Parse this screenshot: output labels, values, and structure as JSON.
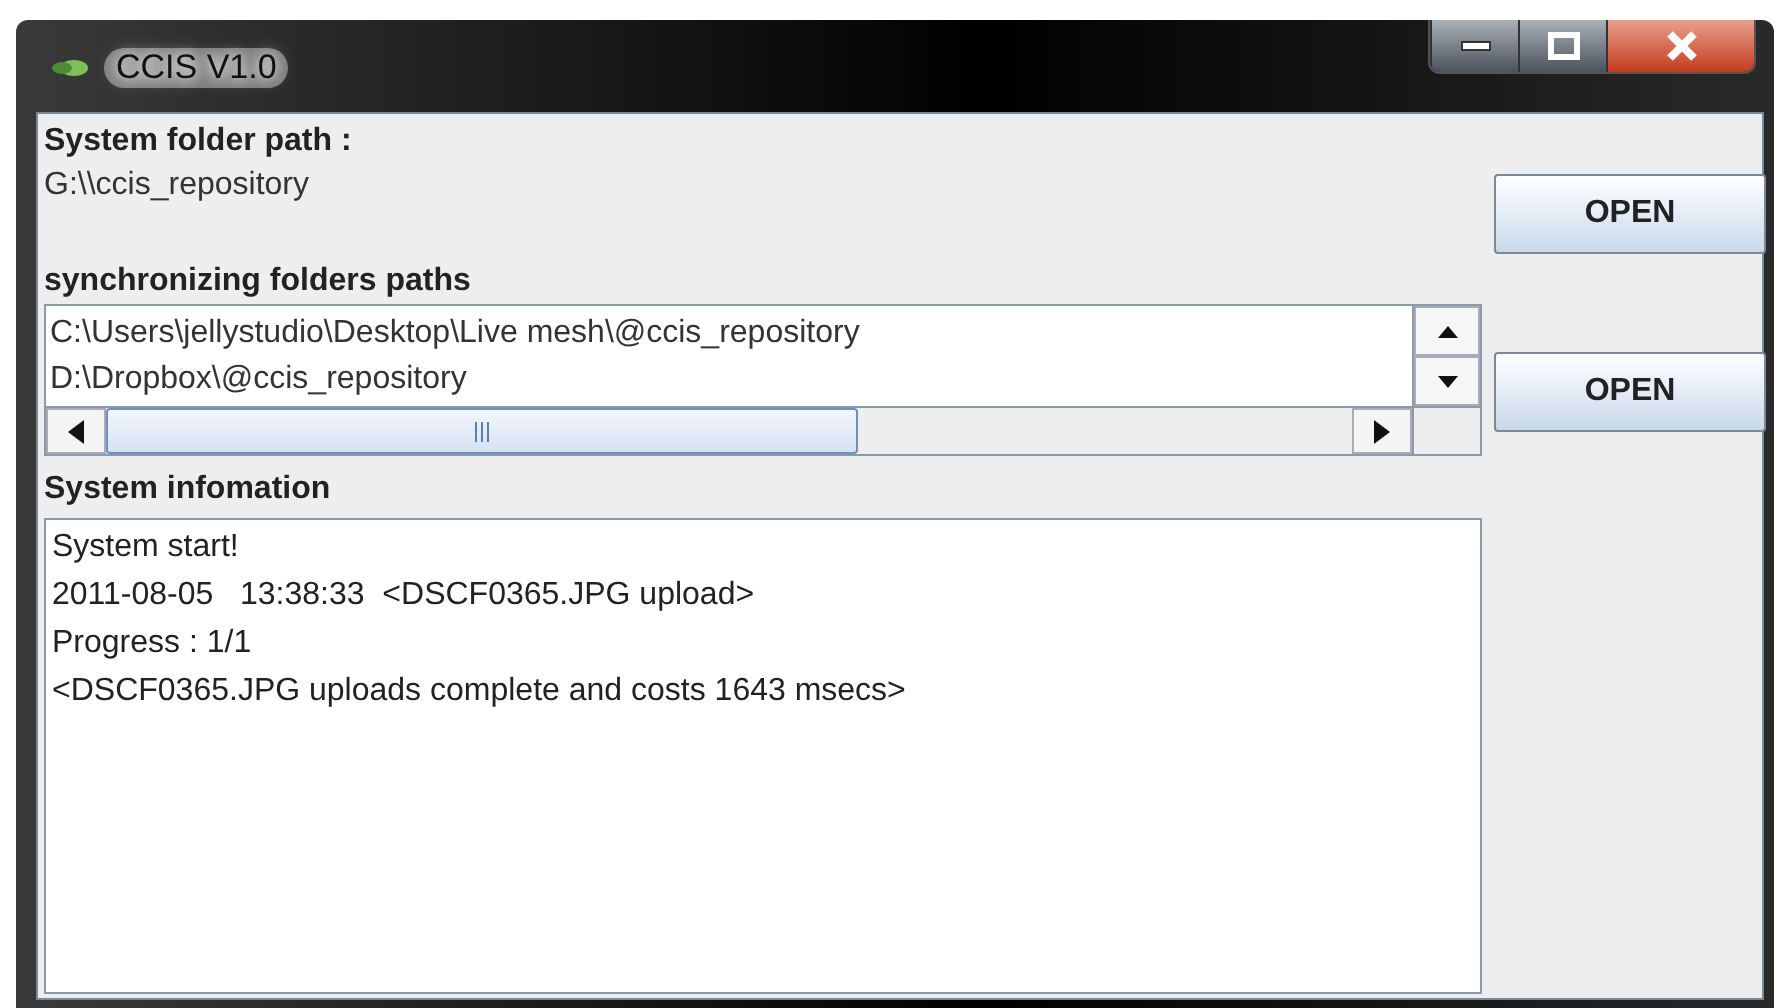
{
  "window": {
    "title": "CCIS V1.0"
  },
  "system_folder": {
    "label": "System folder path :",
    "path": "G:\\\\ccis_repository",
    "button": "OPEN"
  },
  "sync_folders": {
    "label": "synchronizing folders paths",
    "paths": [
      "C:\\Users\\jellystudio\\Desktop\\Live mesh\\@ccis_repository",
      "D:\\Dropbox\\@ccis_repository"
    ],
    "button": "OPEN"
  },
  "system_info": {
    "label": "System infomation",
    "lines": [
      "System start!",
      "2011-08-05   13:38:33  <DSCF0365.JPG upload>",
      "Progress : 1/1",
      "<DSCF0365.JPG uploads complete and costs 1643 msecs>"
    ]
  }
}
